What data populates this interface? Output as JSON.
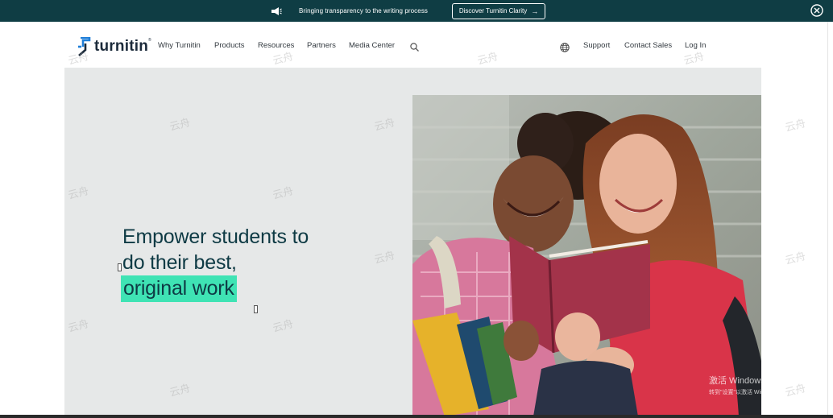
{
  "announcement": {
    "text": "Bringing transparency to the writing process",
    "cta_label": "Discover Turnitin Clarity",
    "cta_arrow": "→",
    "close_icon": "close-circle-icon",
    "megaphone_icon": "megaphone-icon"
  },
  "header": {
    "logo_text": "turnitin",
    "logo_tm": "®",
    "nav": [
      {
        "label": "Why Turnitin"
      },
      {
        "label": "Products"
      },
      {
        "label": "Resources"
      },
      {
        "label": "Partners"
      },
      {
        "label": "Media Center"
      }
    ],
    "search_icon": "search-icon",
    "globe_icon": "globe-icon",
    "right_links": [
      {
        "label": "Support"
      },
      {
        "label": "Contact Sales"
      },
      {
        "label": "Log In"
      }
    ]
  },
  "hero": {
    "headline_line1": "Empower students to",
    "headline_line2": "do their best,",
    "headline_highlight": "original work",
    "image_subject": "two laughing students reading a red book"
  },
  "watermark": {
    "text": "云舟"
  },
  "windows_activation": {
    "title": "激活 Windows",
    "subtitle": "转到\"设置\"以激活 Windows。"
  },
  "colors": {
    "announce_bg": "#0f3d44",
    "hero_bg": "#e6e8e8",
    "headline": "#0e3a44",
    "highlight": "#3fe3b4",
    "logo_blue": "#1f7fd8"
  }
}
